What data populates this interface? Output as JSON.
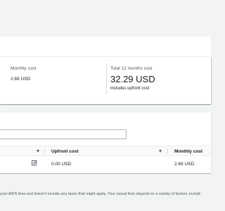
{
  "summary": {
    "monthly_cost_label": "Monthly cost",
    "monthly_cost_value": "2.69 USD",
    "total_label": "Total 12 months cost",
    "total_value": "32.29 USD",
    "total_sub": "Includes upfront cost"
  },
  "table": {
    "filter_placeholder": "",
    "columns": [
      {
        "label": ""
      },
      {
        "label": "Upfront cost"
      },
      {
        "label": "Monthly cost"
      }
    ],
    "rows": [
      {
        "upfront": "0.00 USD",
        "monthly": "2.69 USD"
      }
    ]
  },
  "icons": {
    "sort": "sort-caret-down-icon",
    "edit": "edit-icon"
  },
  "footer": {
    "disclaimer": "your AWS fees and doesn't include any taxes that might apply. Your actual fees depend on a variety of factors, includi"
  },
  "colors": {
    "page_bg": "#f2f3f3",
    "card_bg": "#ffffff",
    "text": "#16191f",
    "muted_text": "#545b64"
  }
}
